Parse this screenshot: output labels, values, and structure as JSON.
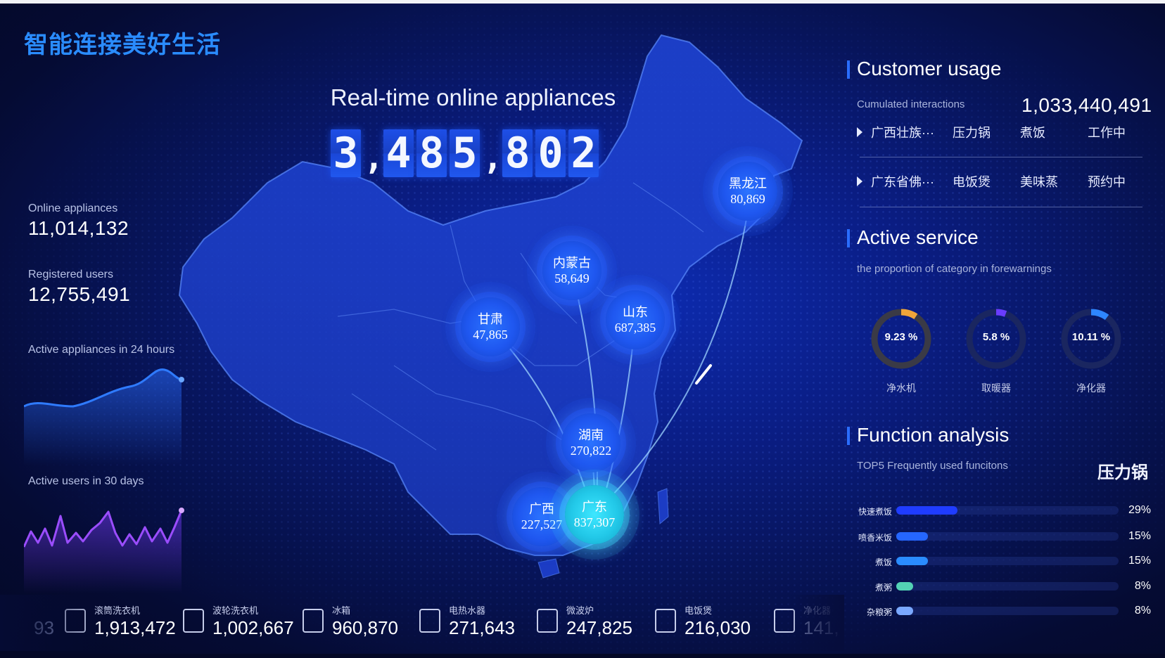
{
  "brand": {
    "title": "智能连接美好生活"
  },
  "header": {
    "title": "Real-time online appliances",
    "counter_digits": [
      "3",
      ",",
      "4",
      "8",
      "5",
      ",",
      "8",
      "0",
      "2"
    ]
  },
  "left": {
    "online": {
      "label": "Online appliances",
      "value": "11,014,132"
    },
    "registered": {
      "label": "Registered users",
      "value": "12,755,491"
    },
    "active24_label": "Active appliances in 24 hours",
    "active30_label": "Active users in 30 days",
    "colors": {
      "line24": "#2f7bff",
      "line30": "#9b4dff"
    }
  },
  "map": {
    "provinces": [
      {
        "name": "黑龙江",
        "value": "80,869",
        "hot": false
      },
      {
        "name": "内蒙古",
        "value": "58,649",
        "hot": false
      },
      {
        "name": "甘肃",
        "value": "47,865",
        "hot": false
      },
      {
        "name": "山东",
        "value": "687,385",
        "hot": false
      },
      {
        "name": "湖南",
        "value": "270,822",
        "hot": false
      },
      {
        "name": "广西",
        "value": "227,527",
        "hot": false
      },
      {
        "name": "广东",
        "value": "837,307",
        "hot": true
      }
    ]
  },
  "customer_usage": {
    "title": "Customer usage",
    "cumulated_label": "Cumulated interactions",
    "cumulated_value": "1,033,440,491",
    "rows": [
      {
        "region": "广西壮族···",
        "appliance": "压力锅",
        "mode": "煮饭",
        "status": "工作中"
      },
      {
        "region": "广东省佛···",
        "appliance": "电饭煲",
        "mode": "美味蒸",
        "status": "预约中"
      }
    ]
  },
  "active_service": {
    "title": "Active service",
    "subtitle": "the proportion of category in forewarnings",
    "donuts": [
      {
        "value": "9.23 %",
        "percent": 9.23,
        "label": "净水机",
        "color": "#f0a53a",
        "track": "#3a3a46"
      },
      {
        "value": "5.8 %",
        "percent": 5.8,
        "label": "取暖器",
        "color": "#6a3cff",
        "track": "#1a2660"
      },
      {
        "value": "10.11 %",
        "percent": 10.11,
        "label": "净化器",
        "color": "#2e86ff",
        "track": "#1a2660"
      }
    ]
  },
  "function_analysis": {
    "title": "Function analysis",
    "subtitle": "TOP5 Frequently used funcitons",
    "top_item": "压力锅",
    "bars": [
      {
        "label": "快速煮饭",
        "percent": 29,
        "pct_text": "29%",
        "color": "#1f3cff"
      },
      {
        "label": "喷香米饭",
        "percent": 15,
        "pct_text": "15%",
        "color": "#2566ff"
      },
      {
        "label": "煮饭",
        "percent": 15,
        "pct_text": "15%",
        "color": "#2a8cff"
      },
      {
        "label": "煮粥",
        "percent": 8,
        "pct_text": "8%",
        "color": "#53d2b4"
      },
      {
        "label": "杂粮粥",
        "percent": 8,
        "pct_text": "8%",
        "color": "#7aa8ff"
      }
    ]
  },
  "bottom_strip": {
    "partial_left": "93",
    "items": [
      {
        "name": "滚筒洗衣机",
        "value": "1,913,472",
        "icon": "washer-icon"
      },
      {
        "name": "波轮洗衣机",
        "value": "1,002,667",
        "icon": "top-loader-icon"
      },
      {
        "name": "冰箱",
        "value": "960,870",
        "icon": "fridge-icon"
      },
      {
        "name": "电热水器",
        "value": "271,643",
        "icon": "water-heater-icon"
      },
      {
        "name": "微波炉",
        "value": "247,825",
        "icon": "microwave-icon"
      },
      {
        "name": "电饭煲",
        "value": "216,030",
        "icon": "rice-cooker-icon"
      },
      {
        "name": "净化器",
        "value": "141,",
        "icon": "purifier-icon"
      }
    ]
  }
}
